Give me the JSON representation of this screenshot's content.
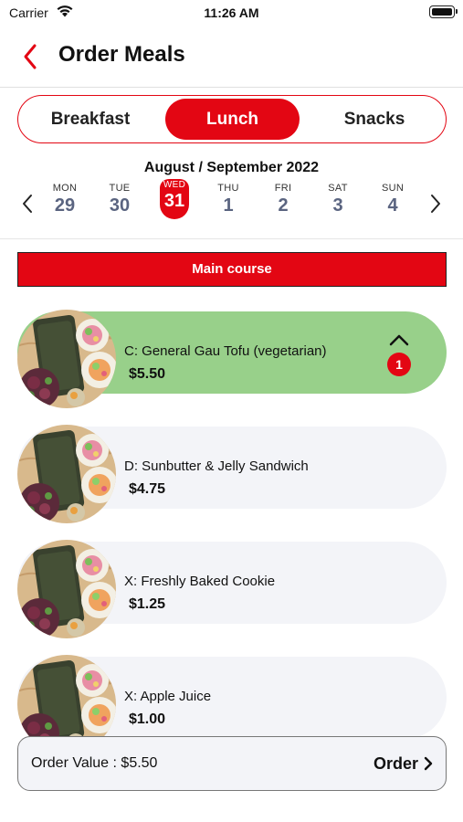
{
  "status_bar": {
    "carrier": "Carrier",
    "time": "11:26 AM"
  },
  "nav": {
    "title": "Order Meals"
  },
  "meal_tabs": [
    {
      "label": "Breakfast",
      "selected": false
    },
    {
      "label": "Lunch",
      "selected": true
    },
    {
      "label": "Snacks",
      "selected": false
    }
  ],
  "calendar": {
    "month_label": "August / September 2022",
    "days": [
      {
        "name": "MON",
        "date": "29"
      },
      {
        "name": "TUE",
        "date": "30"
      },
      {
        "name": "WED",
        "date": "31",
        "selected": true
      },
      {
        "name": "THU",
        "date": "1"
      },
      {
        "name": "FRI",
        "date": "2"
      },
      {
        "name": "SAT",
        "date": "3"
      },
      {
        "name": "SUN",
        "date": "4"
      }
    ]
  },
  "section": {
    "title": "Main course"
  },
  "menu_items": [
    {
      "name": "C: General Gau Tofu (vegetarian)",
      "price": "$5.50",
      "quantity": "1",
      "selected": true
    },
    {
      "name": "D: Sunbutter & Jelly Sandwich",
      "price": "$4.75"
    },
    {
      "name": "X: Freshly Baked Cookie",
      "price": "$1.25"
    },
    {
      "name": "X: Apple Juice",
      "price": "$1.00"
    }
  ],
  "footer": {
    "order_value_label": "Order Value : $5.50",
    "order_button": "Order"
  },
  "colors": {
    "accent": "#e30613",
    "selected_item_bg": "#98d08a",
    "item_bg": "#f3f4f8"
  }
}
